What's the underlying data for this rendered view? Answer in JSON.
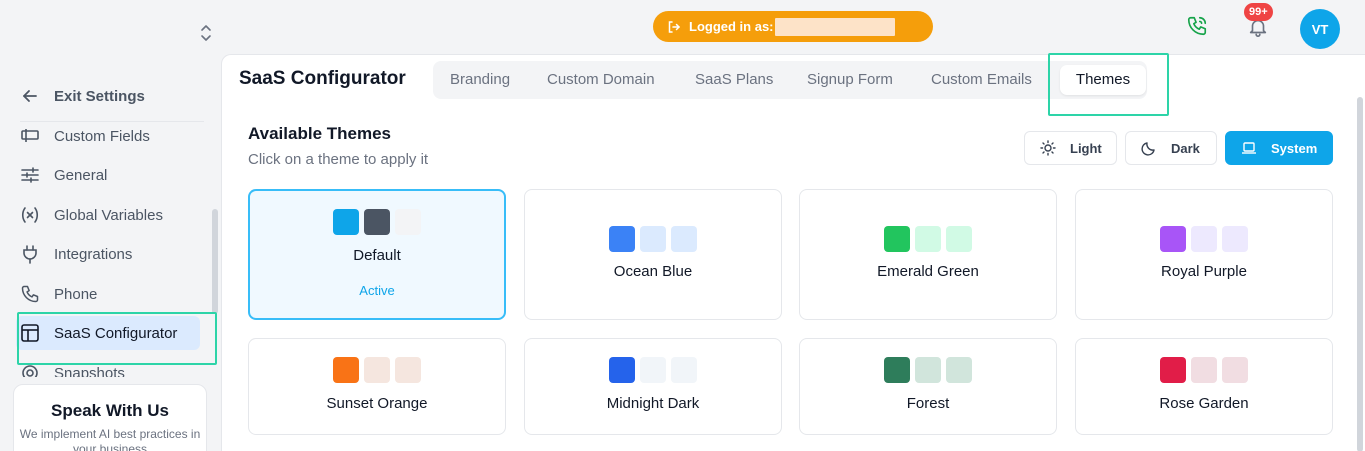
{
  "topbar": {
    "logged_in_label": "Logged in as:",
    "notification_count": "99+",
    "avatar_initials": "VT"
  },
  "sidebar": {
    "exit_label": "Exit Settings",
    "items": [
      {
        "label": "Custom Fields",
        "icon": "custom-fields-icon"
      },
      {
        "label": "General",
        "icon": "sliders-icon"
      },
      {
        "label": "Global Variables",
        "icon": "variable-icon"
      },
      {
        "label": "Integrations",
        "icon": "plug-icon"
      },
      {
        "label": "Phone",
        "icon": "phone-icon"
      },
      {
        "label": "SaaS Configurator",
        "icon": "layout-icon",
        "active": true
      },
      {
        "label": "Snapshots",
        "icon": "snapshot-icon"
      }
    ],
    "promo": {
      "title": "Speak With Us",
      "text": "We implement AI best practices in your business"
    }
  },
  "main": {
    "title": "SaaS Configurator",
    "tabs": [
      {
        "label": "Branding"
      },
      {
        "label": "Custom Domain"
      },
      {
        "label": "SaaS Plans"
      },
      {
        "label": "Signup Form"
      },
      {
        "label": "Custom Emails"
      },
      {
        "label": "Themes",
        "active": true
      }
    ],
    "section_title": "Available Themes",
    "section_subtitle": "Click on a theme to apply it",
    "modes": [
      {
        "label": "Light",
        "icon": "sun-icon"
      },
      {
        "label": "Dark",
        "icon": "moon-icon"
      },
      {
        "label": "System",
        "icon": "laptop-icon",
        "selected": true
      }
    ],
    "themes": [
      {
        "name": "Default",
        "status": "Active",
        "colors": [
          "#0ea5e9",
          "#4b5563",
          "#f3f4f6"
        ]
      },
      {
        "name": "Ocean Blue",
        "colors": [
          "#3b82f6",
          "#dbeafe",
          "#dbeafe"
        ]
      },
      {
        "name": "Emerald Green",
        "colors": [
          "#22c55e",
          "#d1fae5",
          "#d1fae5"
        ]
      },
      {
        "name": "Royal Purple",
        "colors": [
          "#a855f7",
          "#ede9fe",
          "#ede9fe"
        ]
      },
      {
        "name": "Sunset Orange",
        "colors": [
          "#f97316",
          "#f5e6df",
          "#f5e6df"
        ]
      },
      {
        "name": "Midnight Dark",
        "colors": [
          "#2563eb",
          "#f1f5f9",
          "#f1f5f9"
        ]
      },
      {
        "name": "Forest",
        "colors": [
          "#2e7d5b",
          "#d1e5dc",
          "#d1e5dc"
        ]
      },
      {
        "name": "Rose Garden",
        "colors": [
          "#e11d48",
          "#f1dde2",
          "#f1dde2"
        ]
      }
    ]
  },
  "colors": {
    "accent": "#0ea5e9",
    "warning_pill": "#f59e0b",
    "highlight": "#2dd4a8"
  }
}
